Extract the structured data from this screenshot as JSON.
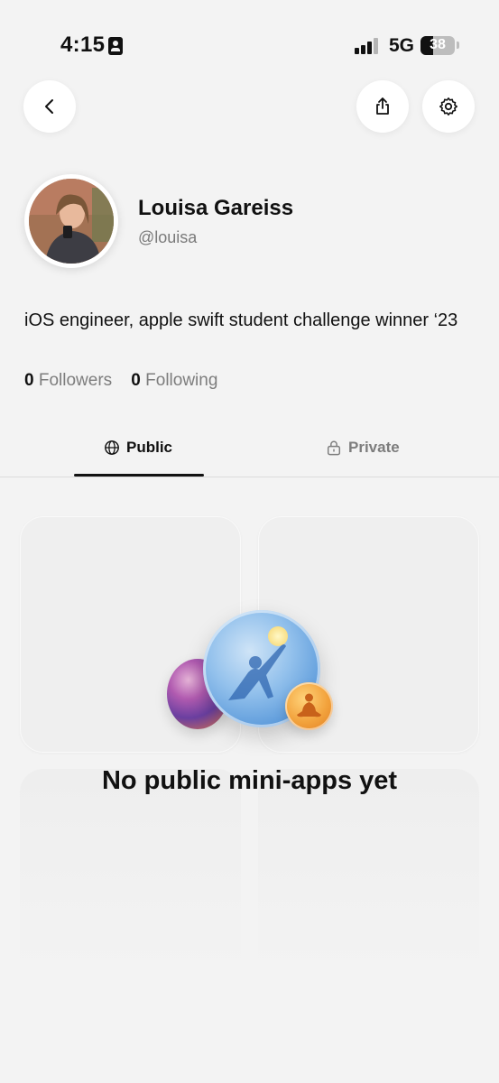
{
  "status_bar": {
    "time": "4:15",
    "network": "5G",
    "battery_pct": "38",
    "battery_level": 0.38
  },
  "header": {
    "back_icon": "chevron-left-icon",
    "share_icon": "share-icon",
    "settings_icon": "gear-icon"
  },
  "profile": {
    "name": "Louisa Gareiss",
    "handle": "@louisa",
    "bio": "iOS engineer, apple swift student challenge winner ‘23",
    "followers_count": "0",
    "followers_label": "Followers",
    "following_count": "0",
    "following_label": "Following"
  },
  "tabs": [
    {
      "label": "Public",
      "icon": "globe-icon",
      "active": true
    },
    {
      "label": "Private",
      "icon": "lock-icon",
      "active": false
    }
  ],
  "empty_state": {
    "title": "No public mini-apps yet"
  }
}
